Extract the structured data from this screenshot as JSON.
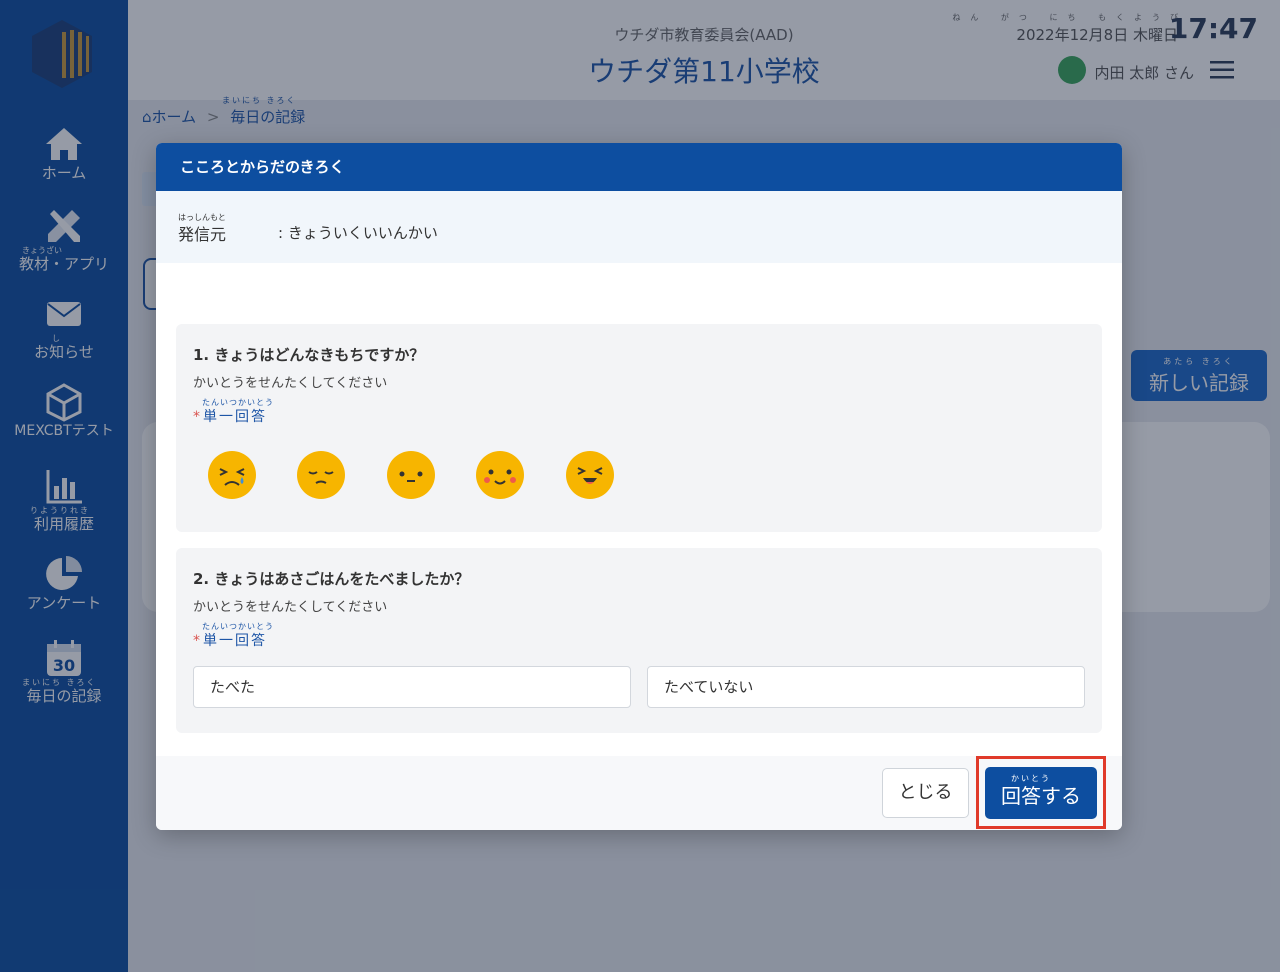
{
  "sidebar": {
    "items": [
      {
        "ruby": "",
        "label": "ホーム"
      },
      {
        "ruby": "きょうざい",
        "label": "教材・アプリ"
      },
      {
        "ruby": "し",
        "label": "お知らせ"
      },
      {
        "ruby": "",
        "label": "MEXCBTテスト"
      },
      {
        "ruby": "りようりれき",
        "label": "利用履歴"
      },
      {
        "ruby": "",
        "label": "アンケート"
      },
      {
        "ruby": "まいにち きろく",
        "label": "毎日の記録",
        "calendar_day": "30"
      }
    ]
  },
  "header": {
    "board": "ウチダ市教育委員会(AAD)",
    "school": "ウチダ第11小学校",
    "date_ruby": "ねん がつ にち もくようび",
    "date": "2022年12月8日 木曜日",
    "time": "17:47",
    "user": "内田 太郎 さん"
  },
  "breadcrumb": {
    "home": "ホーム",
    "separator": ">",
    "current_ruby": "まいにち きろく",
    "current": "毎日の記録"
  },
  "background": {
    "new_record_ruby": "あたら きろく",
    "new_record": "新しい記録"
  },
  "modal": {
    "title": "こころとからだのきろく",
    "sender_ruby": "はっしんもと",
    "sender_label": "発信元",
    "sender_value": ": きょういくいいんかい",
    "questions": [
      {
        "title": "1. きょうはどんなきもちですか？",
        "hint": "かいとうをせんたくしてください",
        "type_ruby": "たんいつかいとう",
        "type": "単一回答",
        "faces": [
          "crying-face-icon",
          "sad-face-icon",
          "neutral-face-icon",
          "smiling-face-icon",
          "happy-face-icon"
        ]
      },
      {
        "title": "2. きょうはあさごはんをたべましたか？",
        "hint": "かいとうをせんたくしてください",
        "type_ruby": "たんいつかいとう",
        "type": "単一回答",
        "options": [
          "たべた",
          "たべていない"
        ]
      }
    ],
    "close_button": "とじる",
    "answer_ruby": "かいとう",
    "answer_button": "回答する"
  },
  "colors": {
    "primary": "#0d4ea0",
    "highlight": "#e03a2a",
    "face": "#f7b500"
  }
}
